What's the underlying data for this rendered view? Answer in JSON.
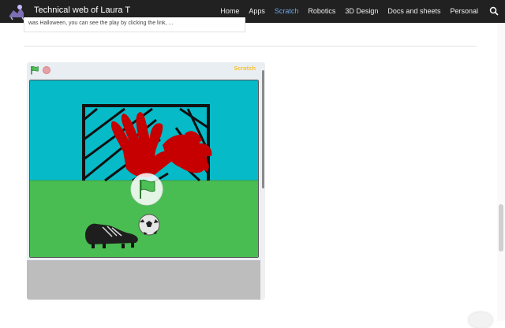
{
  "header": {
    "site_title": "Technical web of Laura T",
    "nav": [
      {
        "label": "Home"
      },
      {
        "label": "Apps"
      },
      {
        "label": "Scratch"
      },
      {
        "label": "Robotics"
      },
      {
        "label": "3D Design"
      },
      {
        "label": "Docs and sheets"
      },
      {
        "label": "Personal"
      }
    ],
    "active_nav": "Scratch",
    "accent_color": "#6aa9e8",
    "icons": {
      "logo": "site-logo-icon",
      "search": "search-icon"
    }
  },
  "card": {
    "snippet": "was Halloween, you can see the play by clicking the link, ..."
  },
  "player": {
    "logo_text": "Scratch",
    "icons": {
      "flag": "green-flag-icon",
      "stop": "stop-icon",
      "stage_flag": "green-flag-icon"
    },
    "scene": {
      "sky_color": "#06bac8",
      "grass_color": "#49bd52",
      "goal": "soccer-goal",
      "goalkeeper_glove": "red-glove",
      "ball": "soccer-ball",
      "shoe": "soccer-shoe"
    }
  }
}
